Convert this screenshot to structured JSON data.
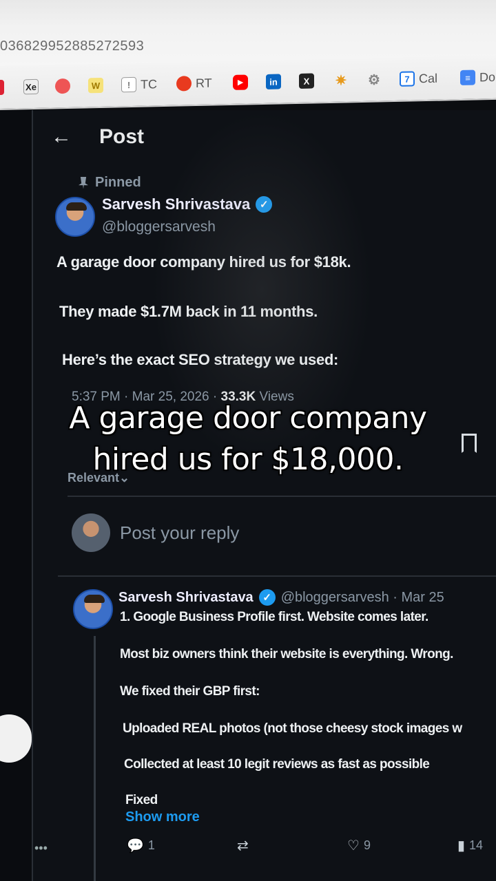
{
  "browser": {
    "url_fragment": "036829952885272593",
    "bookmarks": [
      {
        "icon": "puzzle-icon",
        "label": ""
      },
      {
        "icon": "xe-icon",
        "label": ""
      },
      {
        "icon": "orange-circle-icon",
        "label": ""
      },
      {
        "icon": "w-icon",
        "label": ""
      },
      {
        "icon": "tc-icon",
        "label": "TC"
      },
      {
        "icon": "tomato-icon",
        "label": "RT"
      },
      {
        "icon": "youtube-icon",
        "label": ""
      },
      {
        "icon": "linkedin-icon",
        "label": ""
      },
      {
        "icon": "x-icon",
        "label": ""
      },
      {
        "icon": "spark-icon",
        "label": ""
      },
      {
        "icon": "openai-icon",
        "label": ""
      },
      {
        "icon": "calendar-icon",
        "label": "Cal"
      },
      {
        "icon": "docs-icon",
        "label": "Do"
      }
    ]
  },
  "header": {
    "back_icon": "←",
    "title": "Post"
  },
  "post": {
    "pinned_label": "Pinned",
    "author_name": "Sarvesh Shrivastava",
    "author_handle": "@bloggersarvesh",
    "lines": [
      "A garage door company hired us for $18k.",
      "They made $1.7M back in 11 months.",
      "Here’s the exact SEO strategy we used:"
    ],
    "time": "5:37 PM · Mar 25, 2026 · ",
    "views_count": "33.3K",
    "views_label": " Views",
    "sort_label": "Relevant"
  },
  "reply_box": {
    "placeholder": "Post your reply"
  },
  "reply": {
    "author_name": "Sarvesh Shrivastava",
    "handle_date": "@bloggersarvesh · Mar 25",
    "lines": [
      "1. Google Business Profile first. Website comes later.",
      "Most biz owners think their website is everything. Wrong.",
      "We fixed their GBP first:",
      "Uploaded REAL photos (not those cheesy stock images w",
      "Collected at least 10 legit reviews as fast as possible",
      "Fixed"
    ],
    "show_more": "Show more",
    "replies_count": "1",
    "likes_count": "9",
    "views_count": "14"
  },
  "caption": {
    "line1": "A garage door company",
    "line2": "hired us for $18,000."
  },
  "colors": {
    "accent": "#1d9bf0",
    "background": "#0e1116",
    "text": "#e7e9ea",
    "muted": "#8b98a5"
  }
}
